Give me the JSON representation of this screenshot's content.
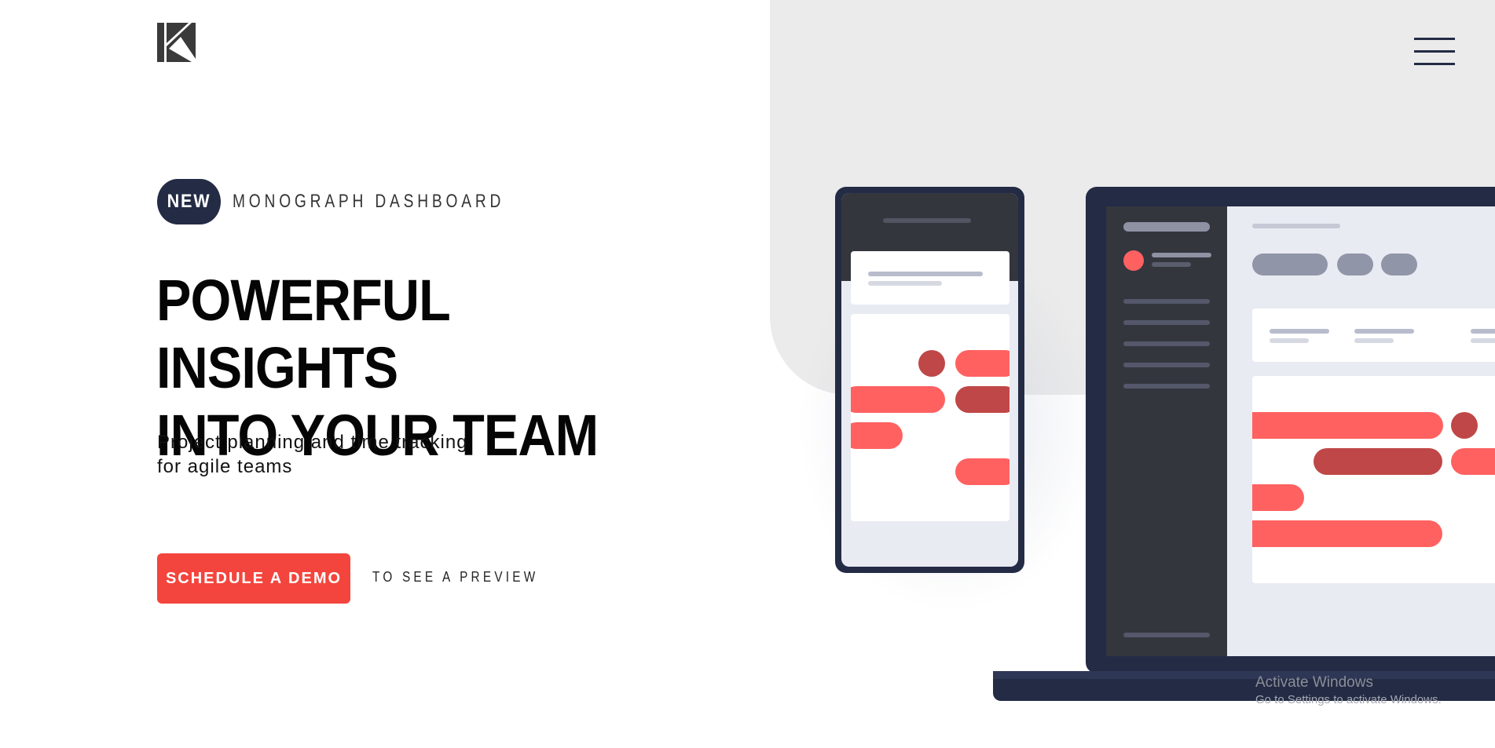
{
  "header": {
    "logo_icon": "logo-k-icon",
    "menu_icon": "hamburger-menu-icon"
  },
  "hero": {
    "badge": "NEW",
    "badge_text": "MONOGRAPH DASHBOARD",
    "headline_line1": "POWERFUL INSIGHTS",
    "headline_line2": "INTO YOUR TEAM",
    "subtext_line1": "Project planning and time tracking",
    "subtext_line2": "for agile teams",
    "cta_label": "SCHEDULE A DEMO",
    "preview_link": "TO SEE A PREVIEW"
  },
  "colors": {
    "accent": "#f3453d",
    "navy": "#242b45",
    "bar_light": "#ff6161",
    "bar_dark": "#bf4747",
    "panel_gray": "#ebebeb"
  },
  "watermark": {
    "title": "Activate Windows",
    "subtitle": "Go to Settings to activate Windows."
  }
}
